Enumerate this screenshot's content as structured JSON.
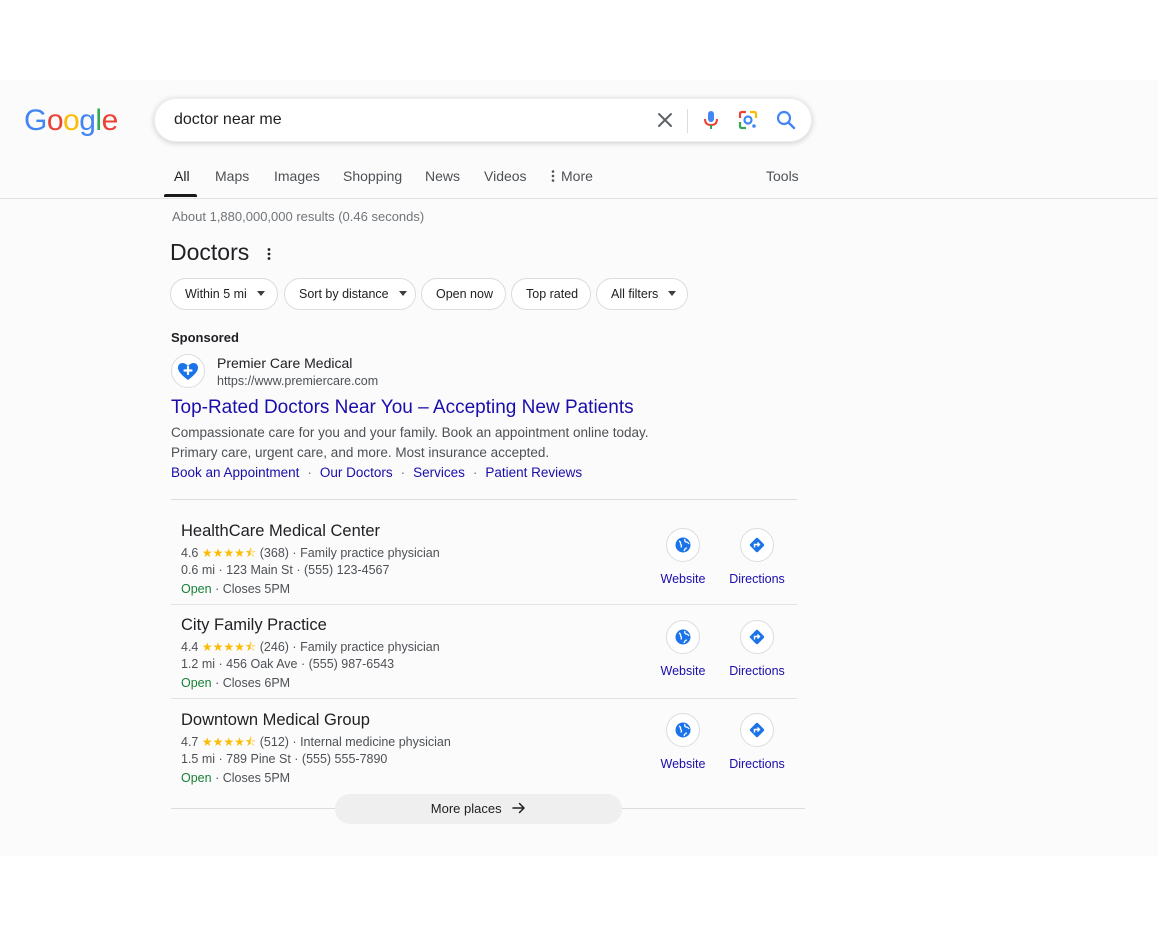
{
  "header": {
    "logo_letters": [
      {
        "ch": "G",
        "color": "#4285F4"
      },
      {
        "ch": "o",
        "color": "#EA4335"
      },
      {
        "ch": "o",
        "color": "#FBBC05"
      },
      {
        "ch": "g",
        "color": "#4285F4"
      },
      {
        "ch": "l",
        "color": "#34A853"
      },
      {
        "ch": "e",
        "color": "#EA4335"
      }
    ],
    "search_query": "doctor near me",
    "icons": [
      "close-icon",
      "mic-icon",
      "lens-icon",
      "search-icon"
    ]
  },
  "tabs": [
    "All",
    "Maps",
    "Images",
    "Shopping",
    "News",
    "Videos",
    "More",
    "Tools"
  ],
  "results_stats": "About 1,880,000,000 results (0.46 seconds)",
  "section_title": "Doctors",
  "filters": [
    "Within 5 mi",
    "Sort by distance",
    "Open now",
    "Top rated",
    "All filters"
  ],
  "ad": {
    "label": "Sponsored",
    "name": "Premier Care Medical",
    "url": "https://www.premiercare.com",
    "headline": "Top-Rated Doctors Near You – Accepting New Patients",
    "desc_line1": "Compassionate care for you and your family. Book an appointment online today.",
    "desc_line2": "Primary care, urgent care, and more. Most insurance accepted.",
    "sitelinks": [
      "Book an Appointment",
      "Our Doctors",
      "Services",
      "Patient Reviews"
    ],
    "separator": "·"
  },
  "places": [
    {
      "name": "HealthCare Medical Center",
      "rating": "4.6",
      "stars": "★★★★⯪",
      "reviews": "(368)",
      "category": "Family practice physician",
      "distance": "0.6 mi",
      "address": "123 Main St",
      "phone": "(555) 123-4567",
      "status": "Open",
      "hours": "Closes 5PM",
      "website_label": "Website",
      "directions_label": "Directions"
    },
    {
      "name": "City Family Practice",
      "rating": "4.4",
      "stars": "★★★★⯪",
      "reviews": "(246)",
      "category": "Family practice physician",
      "distance": "1.2 mi",
      "address": "456 Oak Ave",
      "phone": "(555) 987-6543",
      "status": "Open",
      "hours": "Closes 6PM",
      "website_label": "Website",
      "directions_label": "Directions"
    },
    {
      "name": "Downtown Medical Group",
      "rating": "4.7",
      "stars": "★★★★⯪",
      "reviews": "(512)",
      "category": "Internal medicine physician",
      "distance": "1.5 mi",
      "address": "789 Pine St",
      "phone": "(555) 555-7890",
      "status": "Open",
      "hours": "Closes 5PM",
      "website_label": "Website",
      "directions_label": "Directions"
    }
  ],
  "more_places_label": "More places",
  "colors": {
    "link_blue": "#1a0dab",
    "icon_blue": "#1a73e8",
    "open_green": "#188038",
    "star_yellow": "#fbbc04"
  }
}
